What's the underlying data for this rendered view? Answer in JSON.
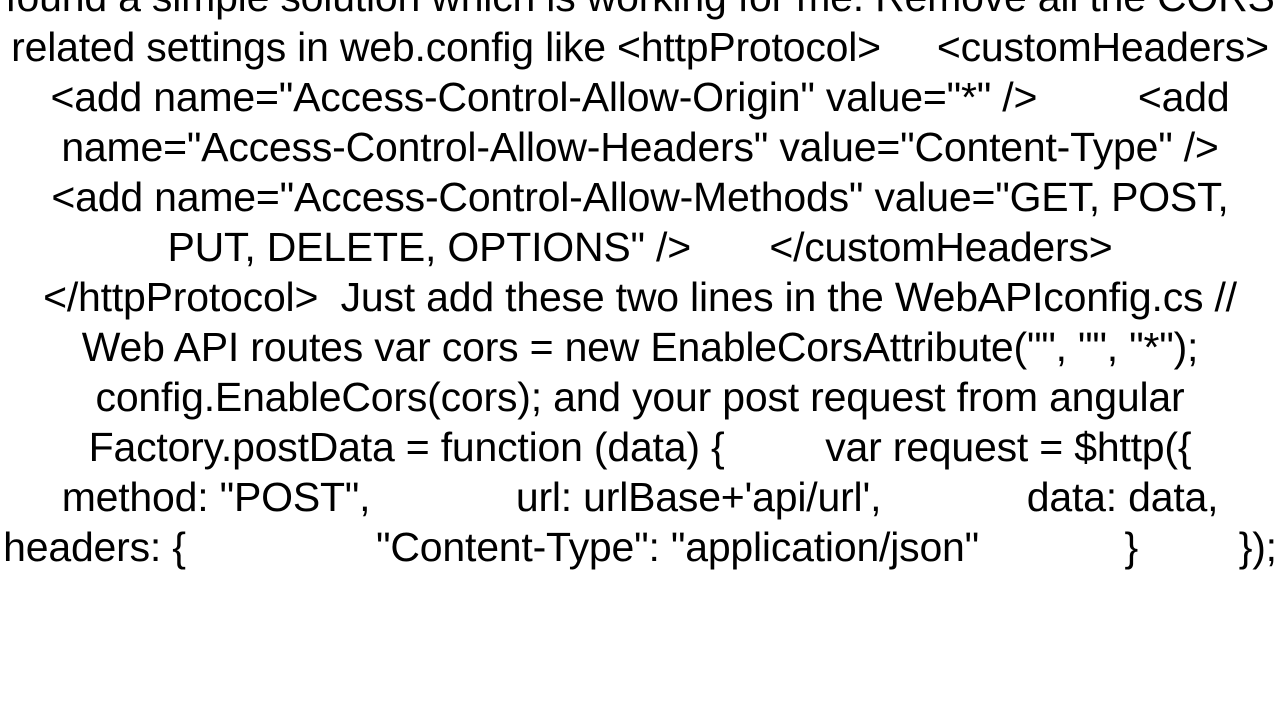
{
  "body_text": "found a simple solution which is working for me. Remove all the CORS related settings in web.config like <httpProtocol>     <customHeaders>         <add name=\"Access-Control-Allow-Origin\" value=\"*\" />         <add name=\"Access-Control-Allow-Headers\" value=\"Content-Type\" />         <add name=\"Access-Control-Allow-Methods\" value=\"GET, POST, PUT, DELETE, OPTIONS\" />       </customHeaders>     </httpProtocol>  Just add these two lines in the WebAPIconfig.cs // Web API routes var cors = new EnableCorsAttribute(\"\", \"\", \"*\");  config.EnableCors(cors); and your post request from angular  Factory.postData = function (data) {         var request = $http({             method: \"POST\",             url: urlBase+'api/url',             data: data,             headers: {                 \"Content-Type\": \"application/json\"             }         });"
}
